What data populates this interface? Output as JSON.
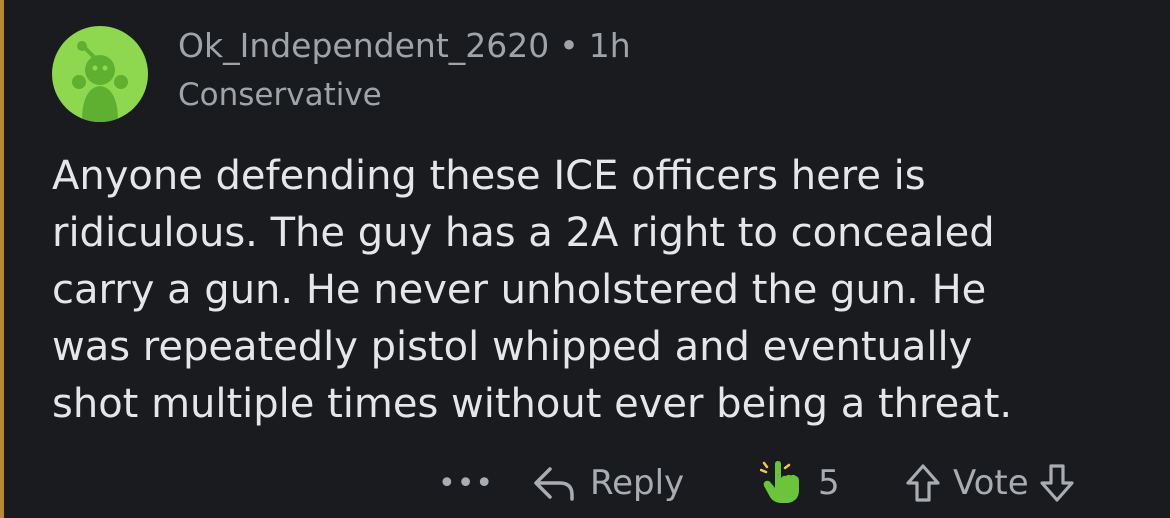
{
  "comment": {
    "username": "Ok_Independent_2620",
    "separator": "•",
    "time": "1h",
    "flair": "Conservative",
    "avatar_icon": "reddit-snoo-avatar-icon",
    "body_lines": [
      "Anyone defending these ICE officers here is",
      "ridiculous. The guy has a 2A right to concealed",
      "carry a gun. He never unholstered the gun. He",
      "was repeatedly pistol whipped and eventually",
      "shot multiple times without ever being a threat."
    ]
  },
  "actions": {
    "more": "•••",
    "reply_label": "Reply",
    "award_count": "5",
    "vote_label": "Vote"
  },
  "colors": {
    "background": "#1a1b1e",
    "thread_line": "#b8892f",
    "avatar_bg": "#8ed84f",
    "meta_text": "#9fa4a8",
    "body_text": "#e4e6e8",
    "award_hand": "#6cc43a"
  }
}
